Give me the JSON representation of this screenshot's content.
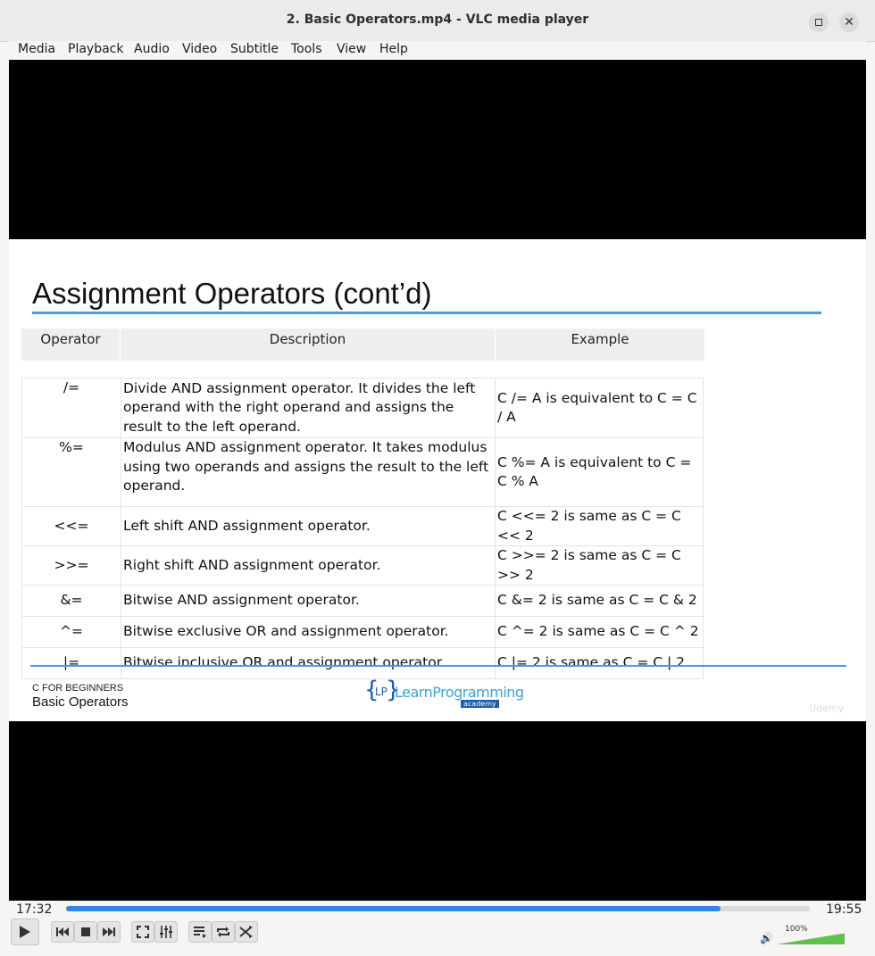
{
  "window": {
    "title": "2. Basic Operators.mp4 - VLC media player"
  },
  "menu": [
    "Media",
    "Playback",
    "Audio",
    "Video",
    "Subtitle",
    "Tools",
    "View",
    "Help"
  ],
  "slide": {
    "title": "Assignment Operators (cont’d)",
    "headers": {
      "operator": "Operator",
      "description": "Description",
      "example": "Example"
    },
    "rows": [
      {
        "op": "/=",
        "desc": "Divide AND assignment operator. It divides the left operand with the right operand and assigns the result to the left operand.",
        "example": "C /= A is equivalent to C = C / A"
      },
      {
        "op": "%=",
        "desc": "Modulus AND assignment operator. It takes modulus using two operands and assigns the result to the left operand.",
        "example": "C %= A is equivalent to C = C % A"
      },
      {
        "op": "<<=",
        "desc": "Left shift AND assignment operator.",
        "example": "C <<= 2 is same as C = C << 2"
      },
      {
        "op": ">>=",
        "desc": "Right shift AND assignment operator.",
        "example": "C >>= 2 is same as C = C >> 2"
      },
      {
        "op": "&=",
        "desc": "Bitwise AND assignment operator.",
        "example": "C &= 2 is same as C = C & 2"
      },
      {
        "op": "^=",
        "desc": "Bitwise exclusive OR and assignment operator.",
        "example": "C ^= 2 is same as C = C ^ 2"
      },
      {
        "op": "|=",
        "desc": "Bitwise inclusive OR and assignment operator.",
        "example": "C |= 2 is same as C = C | 2"
      }
    ],
    "footer": {
      "course": "C FOR BEGINNERS",
      "subject": "Basic Operators"
    },
    "logo": {
      "lp": "LP",
      "text": "LearnProgramming",
      "sub": "academy"
    },
    "watermark": "Udemy"
  },
  "player": {
    "elapsed": "17:32",
    "total": "19:55",
    "progress_fraction": 0.88,
    "volume_label": "100%",
    "volume_fraction": 1.0,
    "accent_color": "#3584e4"
  }
}
